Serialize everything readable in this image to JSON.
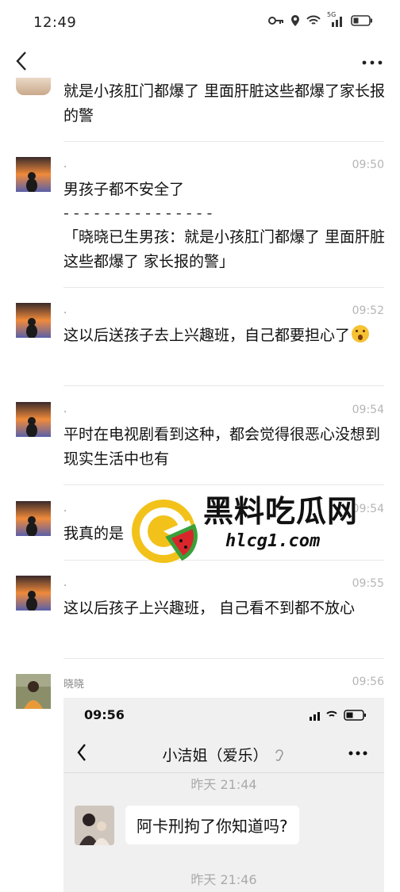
{
  "status_bar": {
    "time": "12:49",
    "network": "5G"
  },
  "messages": [
    {
      "sender": "",
      "time": "",
      "text": "就是小孩肛门都爆了 里面肝脏这些都爆了家长报的警"
    },
    {
      "sender": ".",
      "time": "09:50",
      "text": "男孩子都不安全了",
      "quote_divider": "- - - - - - - - - - - - - - -",
      "quote": "「晓晓已生男孩：就是小孩肛门都爆了 里面肝脏这些都爆了 家长报的警」"
    },
    {
      "sender": ".",
      "time": "09:52",
      "text": "这以后送孩子去上兴趣班，自己都要担心了"
    },
    {
      "sender": ".",
      "time": "09:54",
      "text": "平时在电视剧看到这种，都会觉得很恶心没想到现实生活中也有"
    },
    {
      "sender": ".",
      "time": "09:54",
      "text": "我真的是"
    },
    {
      "sender": ".",
      "time": "09:55",
      "text": "这以后孩子上兴趣班， 自己看不到都不放心"
    },
    {
      "sender": "晓晓",
      "time": "09:56"
    }
  ],
  "watermark": {
    "title": "黑料吃瓜网",
    "url": "hlcg1.com"
  },
  "screenshot": {
    "time": "09:56",
    "title": "小洁姐（爱乐）",
    "timestamp1": "昨天 21:44",
    "bubble": "阿卡刑拘了你知道吗?",
    "timestamp2": "昨天 21:46"
  }
}
